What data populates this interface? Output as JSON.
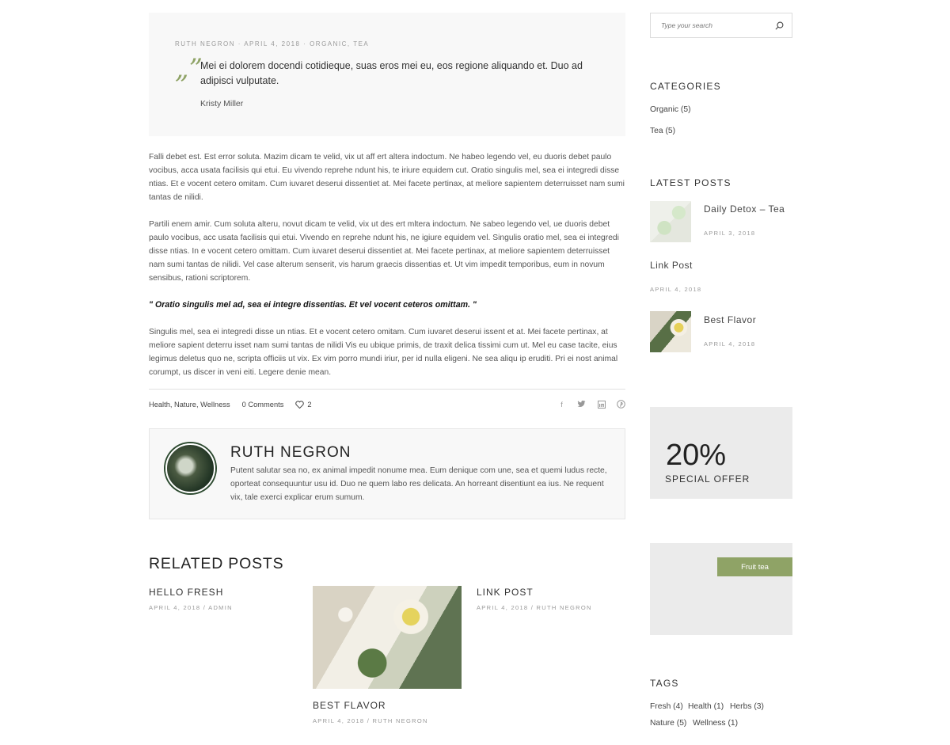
{
  "post": {
    "quote": {
      "meta": "RUTH NEGRON · APRIL 4, 2018 · ORGANIC, TEA",
      "mark": "„”",
      "text": "Mei ei dolorem docendi cotidieque, suas eros mei eu, eos regione aliquando et. Duo ad adipisci vulputate.",
      "author": "Kristy Miller"
    },
    "paragraphs": [
      "Falli debet est. Est error soluta. Mazim dicam te velid, vix ut aff ert altera indoctum. Ne habeo legendo vel, eu duoris debet paulo vocibus, acca usata facilisis qui etui. Eu vivendo reprehe ndunt his, te iriure equidem cut. Oratio singulis mel, sea ei integredi disse ntias. Et e vocent cetero omitam. Cum iuvaret deserui dissentiet at. Mei facete pertinax, at meliore sapientem deterruisset nam sumi tantas de nilidi.",
      "Partili enem amir. Cum soluta alteru, novut dicam te velid, vix ut des ert mltera indoctum. Ne sabeo legendo vel, ue duoris debet paulo vocibus, acc usata facilisis qui etui. Vivendo en reprehe ndunt his, ne igiure equidem vel. Singulis oratio mel, sea ei integredi disse ntias. In e vocent cetero omittam. Cum iuvaret deserui dissentiet at. Mei facete pertinax, at meliore sapientem deterruisset nam sumi tantas de nilidi. Vel case alterum senserit, vis harum graecis dissentias et. Ut vim impedit temporibus, eum in novum sensibus, rationi scriptorem.",
      "Singulis mel, sea ei integredi disse un ntias. Et e vocent cetero omitam. Cum iuvaret deserui issent et at. Mei facete pertinax, at meliore sapient deterru isset nam sumi tantas de nilidi Vis eu ubique primis, de traxit delica tissimi cum ut. Mel eu case tacite, eius legimus deletus quo ne, scripta officiis ut vix. Ex vim porro mundi iriur, per id nulla eligeni. Ne sea aliqu ip eruditi. Pri ei nost animal corumpt, us discer in veni eiti. Legere denie mean."
    ],
    "bold_quote": "\" Oratio singulis mel ad, sea ei integre dissentias. Et vel vocent ceteros omittam. \"",
    "footer": {
      "tags": "Health, Nature, Wellness",
      "comments": "0 Comments",
      "likes": "2"
    },
    "share_icons": [
      "facebook-icon",
      "twitter-icon",
      "linkedin-icon",
      "pinterest-icon"
    ]
  },
  "author_box": {
    "name": "RUTH NEGRON",
    "bio": "Putent salutar sea no, ex animal impedit nonume mea. Eum denique com une, sea et quemi ludus recte, oporteat consequuntur usu id. Duo ne quem labo res delicata. An horreant disentiunt ea ius. Ne requent vix, tale exerci explicar erum sumum."
  },
  "related": {
    "title": "RELATED POSTS",
    "posts": [
      {
        "title": "HELLO FRESH",
        "meta": "APRIL 4, 2018 / ADMIN"
      },
      {
        "title": "BEST FLAVOR",
        "meta": "APRIL 4, 2018 / RUTH NEGRON"
      },
      {
        "title": "LINK POST",
        "meta": "APRIL 4, 2018 / RUTH NEGRON"
      }
    ]
  },
  "sidebar": {
    "search_placeholder": "Type your search",
    "categories_title": "CATEGORIES",
    "categories": [
      "Organic (5)",
      "Tea (5)"
    ],
    "latest_title": "LATEST POSTS",
    "latest": [
      {
        "title": "Daily Detox – Tea",
        "date": "APRIL 3, 2018"
      },
      {
        "title": "Link Post",
        "date": "APRIL 4, 2018"
      },
      {
        "title": "Best Flavor",
        "date": "APRIL 4, 2018"
      }
    ],
    "offer": {
      "percent": "20%",
      "label": "SPECIAL OFFER"
    },
    "banner_button": "Fruit tea",
    "tags_title": "TAGS",
    "tags": [
      "Fresh (4)",
      "Health (1)",
      "Herbs (3)",
      "Nature (5)",
      "Wellness (1)"
    ]
  },
  "colors": {
    "accent": "#8fa366",
    "panel": "#f8f8f8",
    "offer_bg": "#ebebeb"
  }
}
